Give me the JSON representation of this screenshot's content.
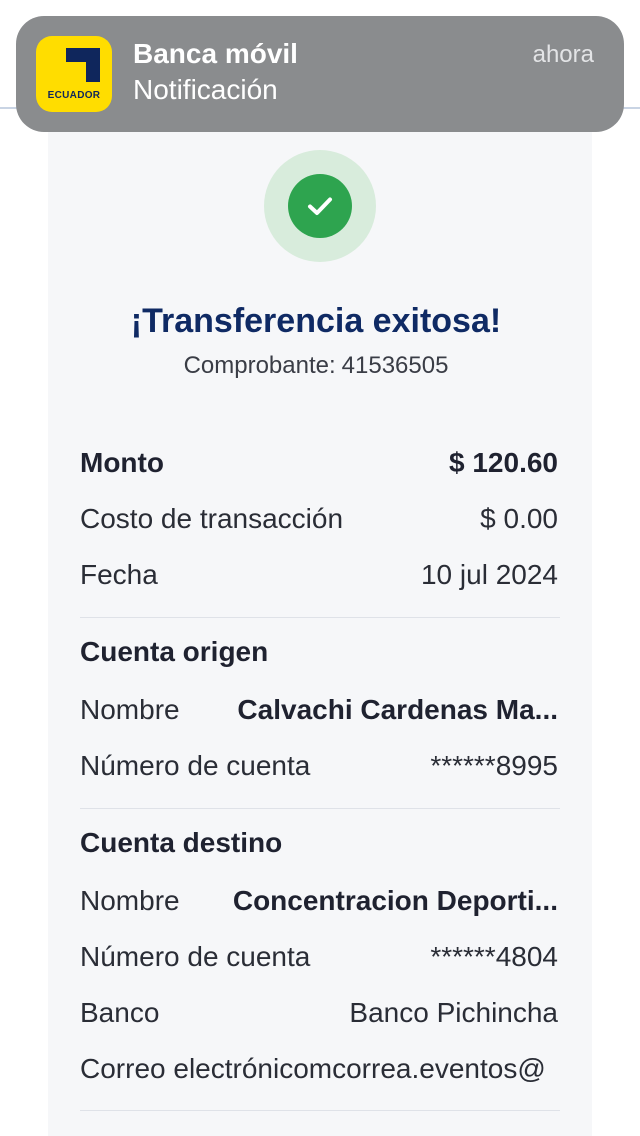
{
  "notification": {
    "app_name": "Banca móvil",
    "body": "Notificación",
    "time": "ahora",
    "app_icon": {
      "name": "banco-pichincha-ecuador-logo",
      "text": "ECUADOR",
      "background_color": "#ffdd00",
      "mark_color": "#0f265c"
    }
  },
  "result": {
    "icon": "check-icon",
    "title": "¡Transferencia exitosa!",
    "voucher_label": "Comprobante:",
    "voucher_number": "41536505",
    "success_color": "#2ea44f"
  },
  "summary": {
    "amount_label": "Monto",
    "amount_value": "$ 120.60",
    "fee_label": "Costo de transacción",
    "fee_value": "$ 0.00",
    "date_label": "Fecha",
    "date_value": "10 jul 2024"
  },
  "origin": {
    "heading": "Cuenta origen",
    "name_label": "Nombre",
    "name_value": "Calvachi  Cardenas Ma...",
    "account_label": "Número de cuenta",
    "account_value": "******8995"
  },
  "destination": {
    "heading": "Cuenta destino",
    "name_label": "Nombre",
    "name_value": "Concentracion Deporti...",
    "account_label": "Número de cuenta",
    "account_value": "******4804",
    "bank_label": "Banco",
    "bank_value": "Banco Pichincha",
    "email_label": "Correo electrónico",
    "email_value": "mcorrea.eventos@"
  },
  "colors": {
    "title_blue": "#0f2a64",
    "card_background": "#f6f7f9"
  }
}
